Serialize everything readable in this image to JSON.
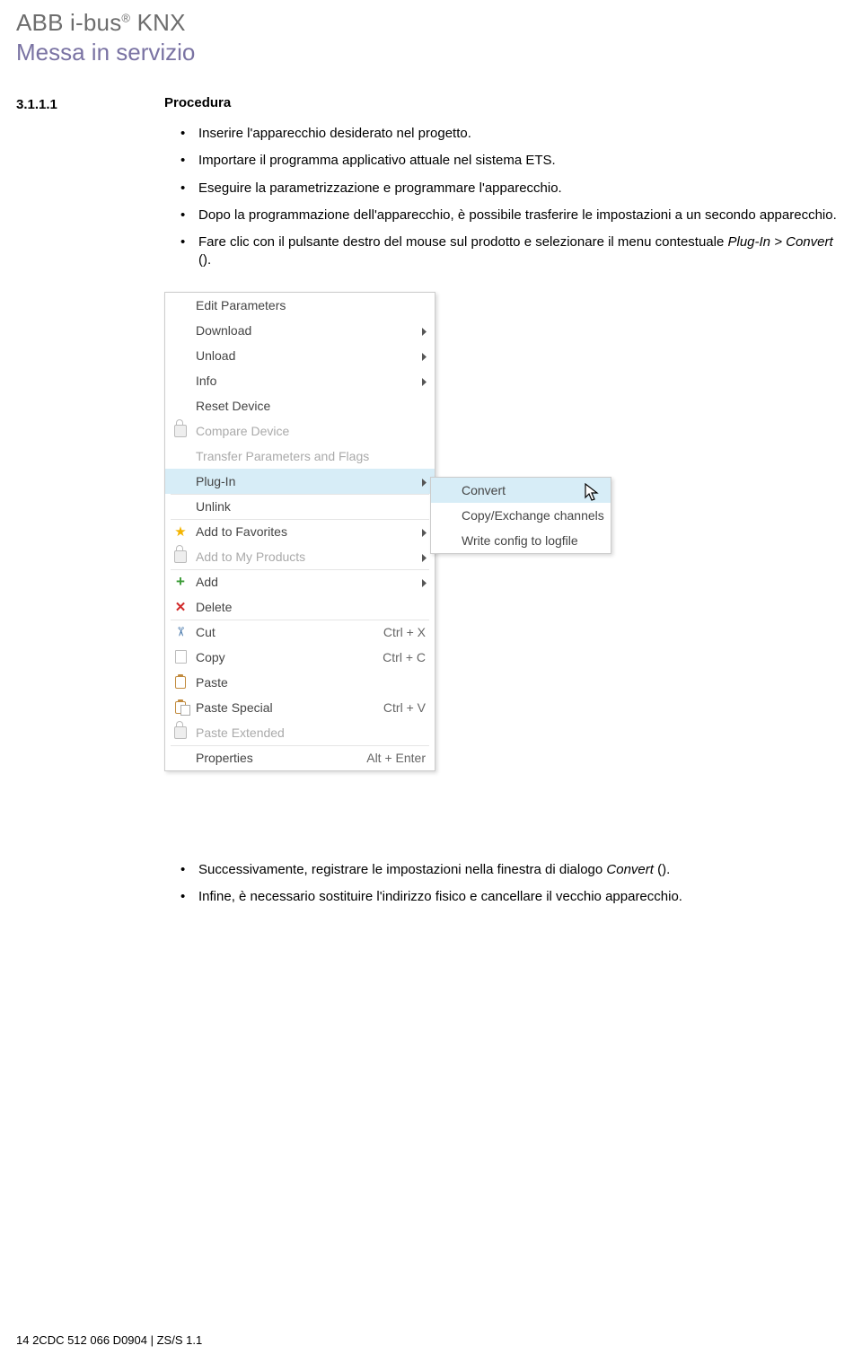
{
  "header": {
    "line1_a": "ABB i-bus",
    "line1_reg": "®",
    "line1_b": " KNX",
    "line2": "Messa in servizio"
  },
  "section": {
    "number": "3.1.1.1",
    "title": "Procedura"
  },
  "bullets_top": [
    "Inserire l'apparecchio desiderato nel progetto.",
    "Importare il programma applicativo attuale nel sistema ETS.",
    "Eseguire la parametrizzazione e programmare l'apparecchio.",
    "Dopo la programmazione dell'apparecchio, è possibile trasferire le impostazioni a un secondo apparecchio."
  ],
  "bullet_context_a": "Fare clic con il pulsante destro del mouse sul prodotto e selezionare il menu contestuale ",
  "bullet_context_i": "Plug-In > Convert",
  "bullet_context_b": " ().",
  "menu_main": [
    {
      "label": "Edit Parameters",
      "icon": null,
      "arrow": false,
      "shortcut": "",
      "disabled": false,
      "hi": false,
      "sep": false
    },
    {
      "label": "Download",
      "icon": null,
      "arrow": true,
      "shortcut": "",
      "disabled": false,
      "hi": false,
      "sep": false
    },
    {
      "label": "Unload",
      "icon": null,
      "arrow": true,
      "shortcut": "",
      "disabled": false,
      "hi": false,
      "sep": false
    },
    {
      "label": "Info",
      "icon": null,
      "arrow": true,
      "shortcut": "",
      "disabled": false,
      "hi": false,
      "sep": false
    },
    {
      "label": "Reset Device",
      "icon": null,
      "arrow": false,
      "shortcut": "",
      "disabled": false,
      "hi": false,
      "sep": false
    },
    {
      "label": "Compare Device",
      "icon": "lock",
      "arrow": false,
      "shortcut": "",
      "disabled": true,
      "hi": false,
      "sep": false
    },
    {
      "label": "Transfer Parameters and Flags",
      "icon": null,
      "arrow": false,
      "shortcut": "",
      "disabled": true,
      "hi": false,
      "sep": true
    },
    {
      "label": "Plug-In",
      "icon": null,
      "arrow": true,
      "shortcut": "",
      "disabled": false,
      "hi": true,
      "sep": true
    },
    {
      "label": "Unlink",
      "icon": null,
      "arrow": false,
      "shortcut": "",
      "disabled": false,
      "hi": false,
      "sep": true
    },
    {
      "label": "Add to Favorites",
      "icon": "star",
      "arrow": true,
      "shortcut": "",
      "disabled": false,
      "hi": false,
      "sep": false
    },
    {
      "label": "Add to My Products",
      "icon": "lock",
      "arrow": true,
      "shortcut": "",
      "disabled": true,
      "hi": false,
      "sep": true
    },
    {
      "label": "Add",
      "icon": "plus",
      "arrow": true,
      "shortcut": "",
      "disabled": false,
      "hi": false,
      "sep": false
    },
    {
      "label": "Delete",
      "icon": "x",
      "arrow": false,
      "shortcut": "",
      "disabled": false,
      "hi": false,
      "sep": true
    },
    {
      "label": "Cut",
      "icon": "cut",
      "arrow": false,
      "shortcut": "Ctrl + X",
      "disabled": false,
      "hi": false,
      "sep": false
    },
    {
      "label": "Copy",
      "icon": "copy",
      "arrow": false,
      "shortcut": "Ctrl + C",
      "disabled": false,
      "hi": false,
      "sep": false
    },
    {
      "label": "Paste",
      "icon": "paste",
      "arrow": false,
      "shortcut": "",
      "disabled": false,
      "hi": false,
      "sep": false
    },
    {
      "label": "Paste Special",
      "icon": "paste2",
      "arrow": false,
      "shortcut": "Ctrl + V",
      "disabled": false,
      "hi": false,
      "sep": false
    },
    {
      "label": "Paste Extended",
      "icon": "lock",
      "arrow": false,
      "shortcut": "",
      "disabled": true,
      "hi": false,
      "sep": true
    },
    {
      "label": "Properties",
      "icon": null,
      "arrow": false,
      "shortcut": "Alt + Enter",
      "disabled": false,
      "hi": false,
      "sep": false
    }
  ],
  "menu_sub": [
    {
      "label": "Convert",
      "hi": true
    },
    {
      "label": "Copy/Exchange channels",
      "hi": false
    },
    {
      "label": "Write config to logfile",
      "hi": false
    }
  ],
  "bullets_bottom_1a": "Successivamente, registrare le impostazioni nella finestra di dialogo ",
  "bullets_bottom_1i": "Convert",
  "bullets_bottom_1b": " ().",
  "bullets_bottom_2": "Infine, è necessario sostituire l'indirizzo fisico e cancellare il vecchio apparecchio.",
  "footer": "14   2CDC 512 066 D0904 | ZS/S 1.1"
}
